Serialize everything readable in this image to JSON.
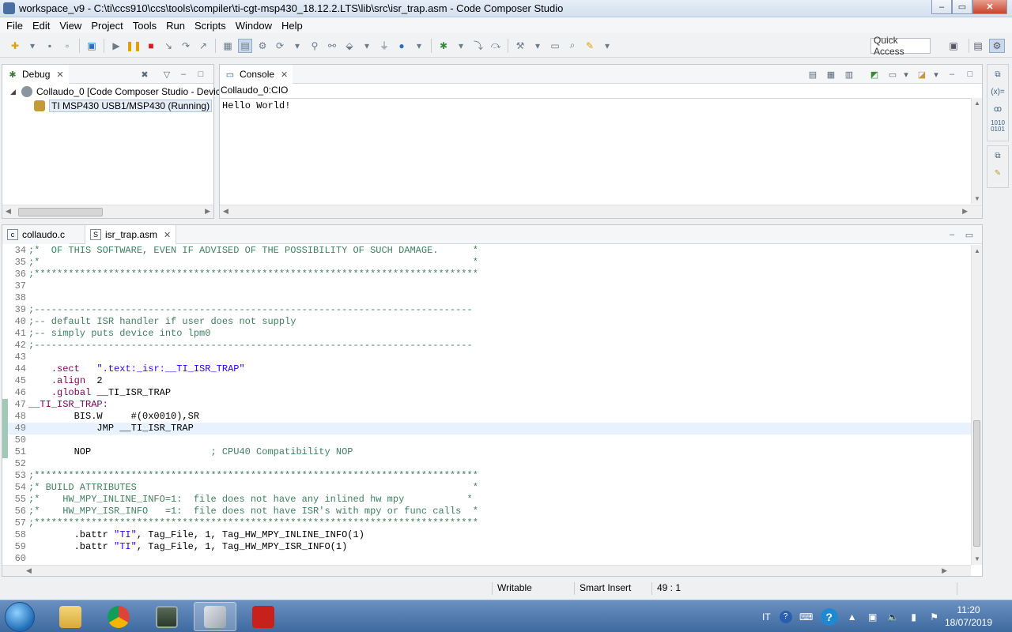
{
  "window": {
    "title": "workspace_v9 - C:\\ti\\ccs910\\ccs\\tools\\compiler\\ti-cgt-msp430_18.12.2.LTS\\lib\\src\\isr_trap.asm - Code Composer Studio",
    "minimize": "–",
    "restore": "▭",
    "close": "✕"
  },
  "menu": [
    "File",
    "Edit",
    "View",
    "Project",
    "Tools",
    "Run",
    "Scripts",
    "Window",
    "Help"
  ],
  "toolbar": {
    "quick_access": "Quick Access"
  },
  "debug": {
    "tab_label": "Debug",
    "root": "Collaudo_0 [Code Composer Studio - Devic",
    "child": "TI MSP430 USB1/MSP430 (Running)"
  },
  "console": {
    "tab_label": "Console",
    "subtitle": "Collaudo_0:CIO",
    "output": "Hello World!"
  },
  "editor": {
    "tabs": [
      {
        "label": "collaudo.c",
        "icon": "c"
      },
      {
        "label": "isr_trap.asm",
        "icon": "S"
      }
    ],
    "lines": [
      {
        "n": "34",
        "text": ";*  OF THIS SOFTWARE, EVEN IF ADVISED OF THE POSSIBILITY OF SUCH DAMAGE.      *",
        "cls": "c-green"
      },
      {
        "n": "35",
        "text": ";*                                                                            *",
        "cls": "c-green"
      },
      {
        "n": "36",
        "text": ";******************************************************************************",
        "cls": "c-green"
      },
      {
        "n": "37",
        "text": "",
        "cls": ""
      },
      {
        "n": "38",
        "text": "",
        "cls": ""
      },
      {
        "n": "39",
        "text": ";-----------------------------------------------------------------------------",
        "cls": "c-green"
      },
      {
        "n": "40",
        "text": ";-- default ISR handler if user does not supply",
        "cls": "c-green"
      },
      {
        "n": "41",
        "text": ";-- simply puts device into lpm0",
        "cls": "c-green"
      },
      {
        "n": "42",
        "text": ";-----------------------------------------------------------------------------",
        "cls": "c-green"
      },
      {
        "n": "43",
        "text": "",
        "cls": ""
      },
      {
        "n": "44",
        "text": "",
        "cls": "",
        "parts": [
          [
            "    ",
            ""
          ],
          [
            ".sect",
            "c-maroon"
          ],
          [
            "   ",
            ""
          ],
          [
            "\".text:_isr:__TI_ISR_TRAP\"",
            "c-blue"
          ]
        ]
      },
      {
        "n": "45",
        "text": "",
        "cls": "",
        "parts": [
          [
            "    ",
            ""
          ],
          [
            ".align",
            "c-maroon"
          ],
          [
            "  2",
            ""
          ]
        ]
      },
      {
        "n": "46",
        "text": "",
        "cls": "",
        "parts": [
          [
            "    ",
            ""
          ],
          [
            ".global",
            "c-maroon"
          ],
          [
            " __TI_ISR_TRAP",
            ""
          ]
        ]
      },
      {
        "n": "47",
        "text": "__TI_ISR_TRAP:",
        "cls": "c-maroon"
      },
      {
        "n": "48",
        "text": "        BIS.W     #(0x0010),SR",
        "cls": ""
      },
      {
        "n": "49",
        "text": "            JMP __TI_ISR_TRAP",
        "cls": "",
        "current": true
      },
      {
        "n": "50",
        "text": "",
        "cls": ""
      },
      {
        "n": "51",
        "text": "",
        "cls": "",
        "parts": [
          [
            "        NOP                     ",
            ""
          ],
          [
            "; CPU40 Compatibility NOP",
            "c-green"
          ]
        ]
      },
      {
        "n": "52",
        "text": "",
        "cls": ""
      },
      {
        "n": "53",
        "text": ";******************************************************************************",
        "cls": "c-green"
      },
      {
        "n": "54",
        "text": ";* BUILD ATTRIBUTES                                                           *",
        "cls": "c-green"
      },
      {
        "n": "55",
        "text": ";*    HW_MPY_INLINE_INFO=1:  file does not have any inlined hw mpy           *",
        "cls": "c-green"
      },
      {
        "n": "56",
        "text": ";*    HW_MPY_ISR_INFO   =1:  file does not have ISR's with mpy or func calls  *",
        "cls": "c-green"
      },
      {
        "n": "57",
        "text": ";******************************************************************************",
        "cls": "c-green"
      },
      {
        "n": "58",
        "text": "",
        "cls": "",
        "parts": [
          [
            "        .battr ",
            ""
          ],
          [
            "\"TI\"",
            "c-blue"
          ],
          [
            ", Tag_File, 1, Tag_HW_MPY_INLINE_INFO(1)",
            ""
          ]
        ]
      },
      {
        "n": "59",
        "text": "",
        "cls": "",
        "parts": [
          [
            "        .battr ",
            ""
          ],
          [
            "\"TI\"",
            "c-blue"
          ],
          [
            ", Tag_File, 1, Tag_HW_MPY_ISR_INFO(1)",
            ""
          ]
        ]
      },
      {
        "n": "60",
        "text": "",
        "cls": ""
      }
    ]
  },
  "status": {
    "writable": "Writable",
    "insert_mode": "Smart Insert",
    "position": "49 : 1"
  },
  "taskbar": {
    "language": "IT",
    "time": "11:20",
    "date": "18/07/2019"
  }
}
